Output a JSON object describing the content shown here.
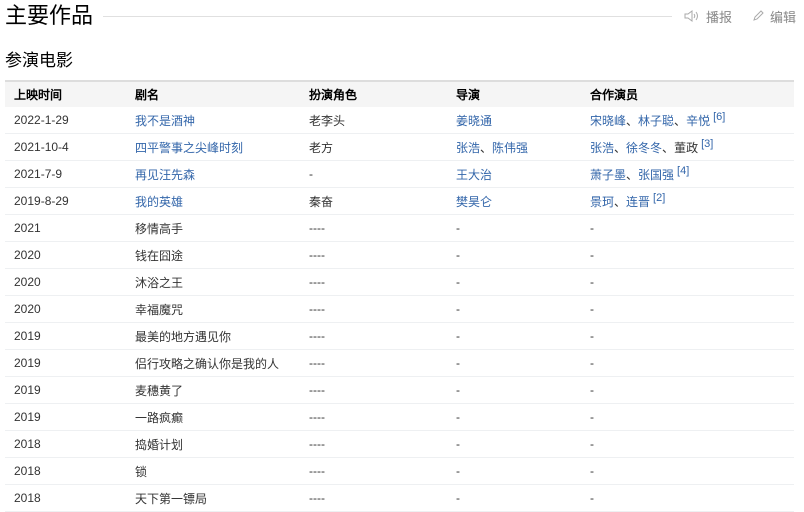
{
  "header": {
    "title": "主要作品",
    "broadcast_label": "播报",
    "edit_label": "编辑"
  },
  "section": {
    "title": "参演电影"
  },
  "table": {
    "columns": [
      "上映时间",
      "剧名",
      "扮演角色",
      "导演",
      "合作演员"
    ],
    "rows": [
      {
        "date": "2022-1-29",
        "title": "我不是酒神",
        "title_link": true,
        "role": "老李头",
        "directors": [
          {
            "name": "姜晓通",
            "link": true
          }
        ],
        "costars": [
          {
            "name": "宋晓峰",
            "link": true
          },
          {
            "name": "林子聪",
            "link": true
          },
          {
            "name": "辛悦",
            "link": true
          }
        ],
        "ref": "[6]"
      },
      {
        "date": "2021-10-4",
        "title": "四平警事之尖峰时刻",
        "title_link": true,
        "role": "老方",
        "directors": [
          {
            "name": "张浩",
            "link": true
          },
          {
            "name": "陈伟强",
            "link": true
          }
        ],
        "costars": [
          {
            "name": "张浩",
            "link": true
          },
          {
            "name": "徐冬冬",
            "link": true
          },
          {
            "name": "董政",
            "link": false
          }
        ],
        "ref": "[3]"
      },
      {
        "date": "2021-7-9",
        "title": "再见汪先森",
        "title_link": true,
        "role": "-",
        "directors": [
          {
            "name": "王大治",
            "link": true
          }
        ],
        "costars": [
          {
            "name": "萧子墨",
            "link": true
          },
          {
            "name": "张国强",
            "link": true
          }
        ],
        "ref": "[4]"
      },
      {
        "date": "2019-8-29",
        "title": "我的英雄",
        "title_link": true,
        "role": "秦奋",
        "directors": [
          {
            "name": "樊昊仑",
            "link": true
          }
        ],
        "costars": [
          {
            "name": "景珂",
            "link": true
          },
          {
            "name": "连晋",
            "link": true
          }
        ],
        "ref": "[2]"
      },
      {
        "date": "2021",
        "title": "移情高手",
        "title_link": false,
        "role": "----",
        "directors": [
          {
            "name": "-",
            "link": false
          }
        ],
        "costars": [
          {
            "name": "-",
            "link": false
          }
        ],
        "ref": ""
      },
      {
        "date": "2020",
        "title": "钱在囧途",
        "title_link": false,
        "role": "----",
        "directors": [
          {
            "name": "-",
            "link": false
          }
        ],
        "costars": [
          {
            "name": "-",
            "link": false
          }
        ],
        "ref": ""
      },
      {
        "date": "2020",
        "title": "沐浴之王",
        "title_link": false,
        "role": "----",
        "directors": [
          {
            "name": "-",
            "link": false
          }
        ],
        "costars": [
          {
            "name": "-",
            "link": false
          }
        ],
        "ref": ""
      },
      {
        "date": "2020",
        "title": "幸福魔咒",
        "title_link": false,
        "role": "----",
        "directors": [
          {
            "name": "-",
            "link": false
          }
        ],
        "costars": [
          {
            "name": "-",
            "link": false
          }
        ],
        "ref": ""
      },
      {
        "date": "2019",
        "title": "最美的地方遇见你",
        "title_link": false,
        "role": "----",
        "directors": [
          {
            "name": "-",
            "link": false
          }
        ],
        "costars": [
          {
            "name": "-",
            "link": false
          }
        ],
        "ref": ""
      },
      {
        "date": "2019",
        "title": "侣行攻略之确认你是我的人",
        "title_link": false,
        "role": "----",
        "directors": [
          {
            "name": "-",
            "link": false
          }
        ],
        "costars": [
          {
            "name": "-",
            "link": false
          }
        ],
        "ref": ""
      },
      {
        "date": "2019",
        "title": "麦穗黄了",
        "title_link": false,
        "role": "----",
        "directors": [
          {
            "name": "-",
            "link": false
          }
        ],
        "costars": [
          {
            "name": "-",
            "link": false
          }
        ],
        "ref": ""
      },
      {
        "date": "2019",
        "title": "一路疯癫",
        "title_link": false,
        "role": "----",
        "directors": [
          {
            "name": "-",
            "link": false
          }
        ],
        "costars": [
          {
            "name": "-",
            "link": false
          }
        ],
        "ref": ""
      },
      {
        "date": "2018",
        "title": "捣婚计划",
        "title_link": false,
        "role": "----",
        "directors": [
          {
            "name": "-",
            "link": false
          }
        ],
        "costars": [
          {
            "name": "-",
            "link": false
          }
        ],
        "ref": ""
      },
      {
        "date": "2018",
        "title": "锁",
        "title_link": false,
        "role": "----",
        "directors": [
          {
            "name": "-",
            "link": false
          }
        ],
        "costars": [
          {
            "name": "-",
            "link": false
          }
        ],
        "ref": ""
      },
      {
        "date": "2018",
        "title": "天下第一镖局",
        "title_link": false,
        "role": "----",
        "directors": [
          {
            "name": "-",
            "link": false
          }
        ],
        "costars": [
          {
            "name": "-",
            "link": false
          }
        ],
        "ref": ""
      }
    ]
  }
}
